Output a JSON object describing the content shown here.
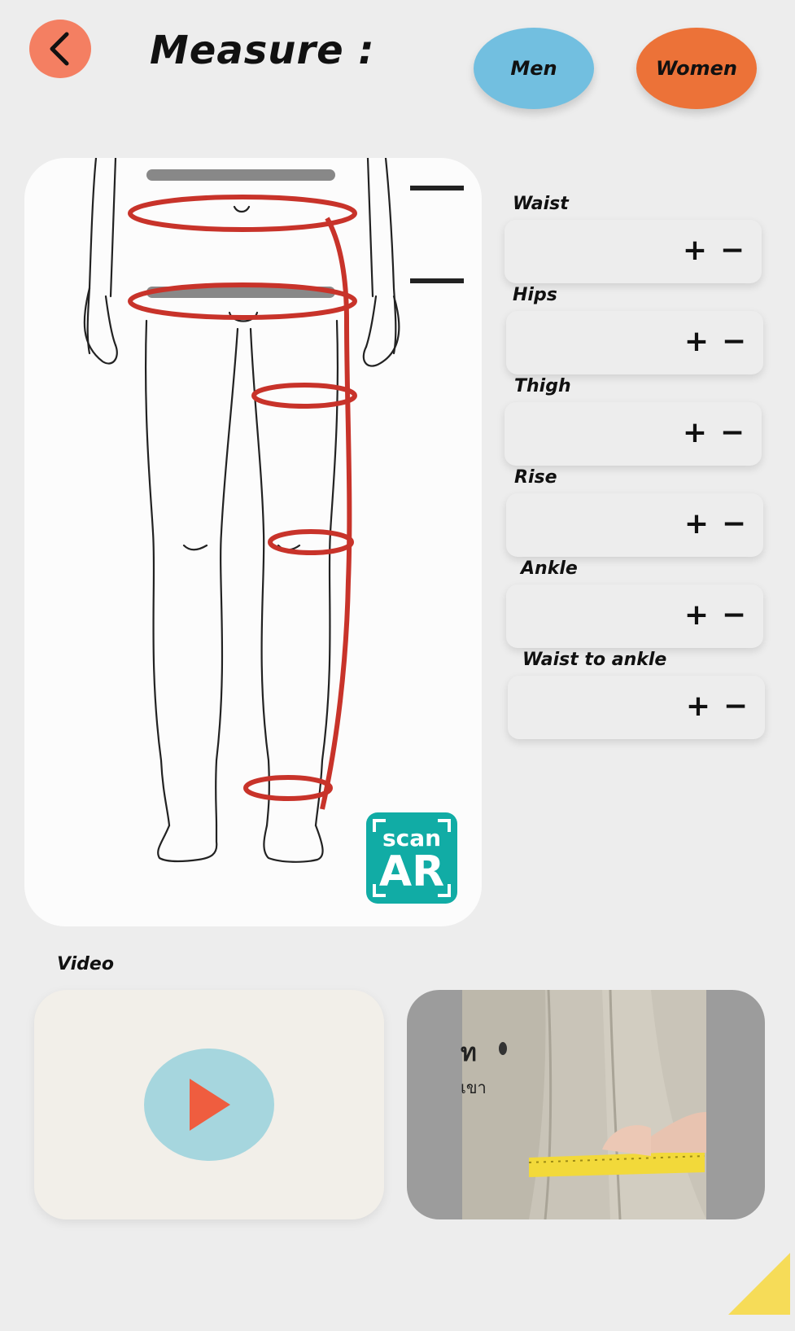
{
  "header": {
    "title": "Measure :",
    "men_label": "Men",
    "women_label": "Women"
  },
  "colors": {
    "background": "#ededed",
    "back_button": "#f47f62",
    "men_button": "#72bfe0",
    "women_button": "#ec7238",
    "measure_line": "#c8332a",
    "scan_ar": "#11aca5",
    "play_button": "#a6d6de",
    "play_arrow": "#ef5d3f",
    "corner_accent": "#f6dc58"
  },
  "scan_ar": {
    "top": "scan",
    "bottom": "AR"
  },
  "measurements": [
    {
      "label": "Waist",
      "plus": "+",
      "minus": "−"
    },
    {
      "label": "Hips",
      "plus": "+",
      "minus": "−"
    },
    {
      "label": "Thigh",
      "plus": "+",
      "minus": "−"
    },
    {
      "label": "Rise",
      "plus": "+",
      "minus": "−"
    },
    {
      "label": "Ankle",
      "plus": "+",
      "minus": "−"
    },
    {
      "label": "Waist to ankle",
      "plus": "+",
      "minus": "−"
    }
  ],
  "video": {
    "label": "Video",
    "thumbnail_text_1": "ท",
    "thumbnail_text_2": "เขา"
  },
  "icons": {
    "back": "chevron-left-icon",
    "play": "play-icon"
  }
}
